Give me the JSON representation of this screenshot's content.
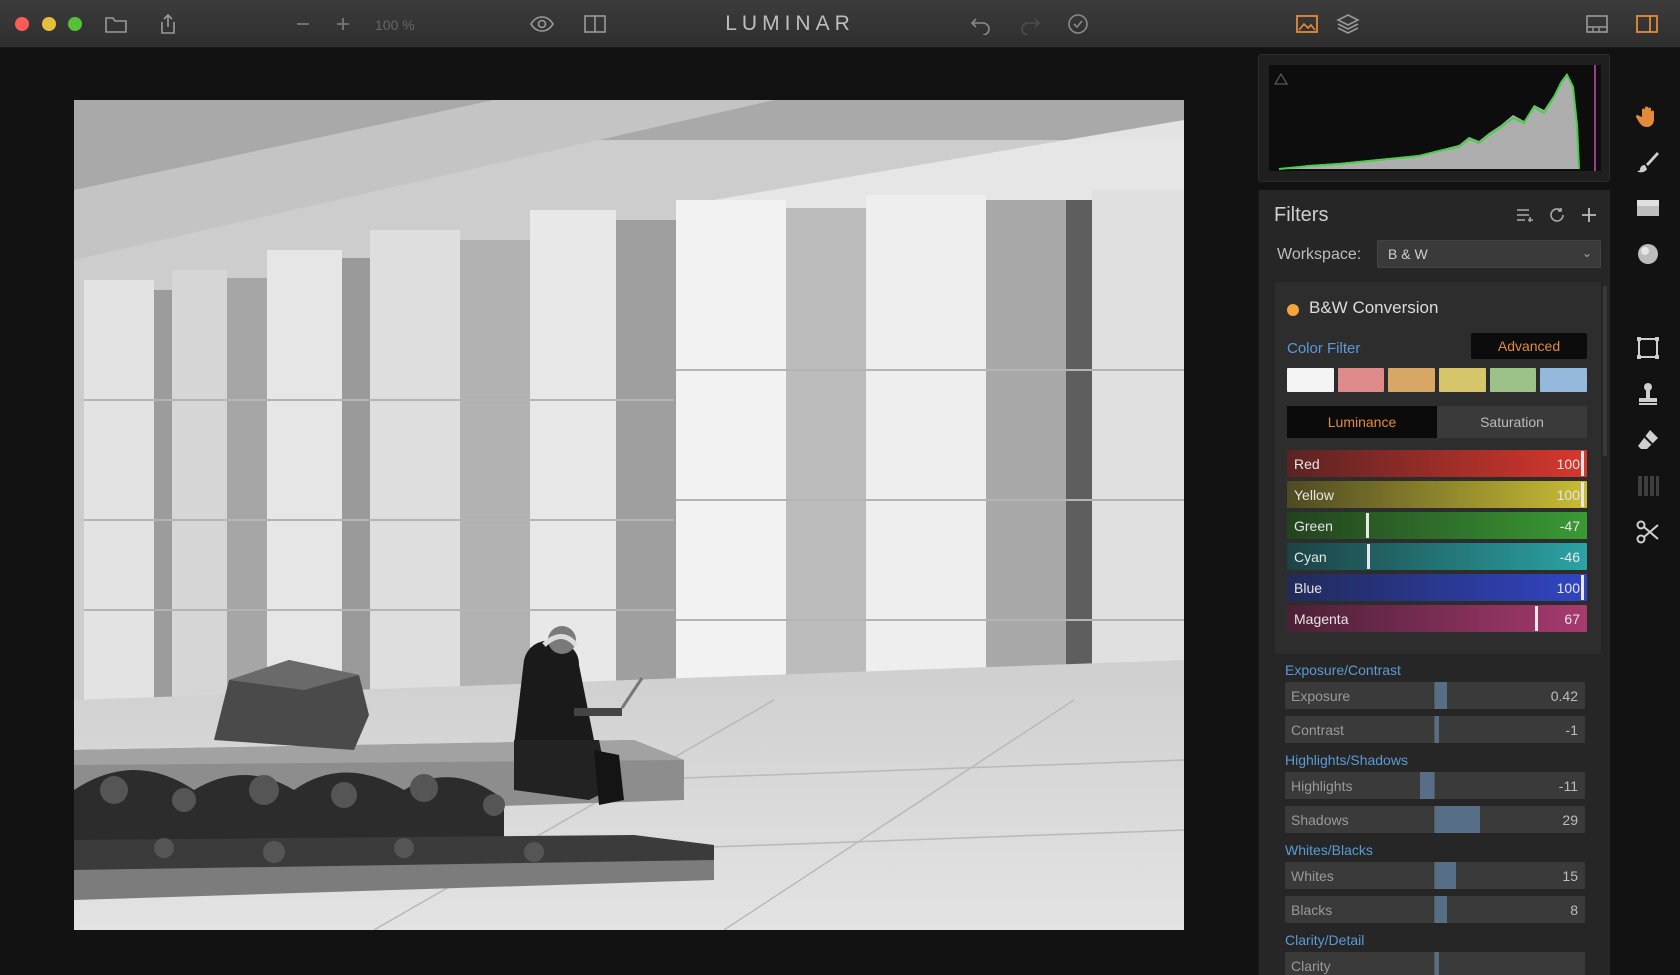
{
  "app": {
    "title": "LUMINAR",
    "zoom": "100 %"
  },
  "colors": {
    "accent": "#e38b3a",
    "section": "#5a9bd6",
    "panel": "#262626"
  },
  "toolbar": {
    "left_icons": [
      "folder-icon",
      "share-icon"
    ],
    "zoom_icons": [
      "zoom-out-icon",
      "zoom-in-icon"
    ],
    "view_icons": [
      "eye-icon",
      "compare-icon"
    ],
    "history_icons": [
      "undo-icon",
      "redo-icon",
      "history-icon"
    ],
    "panel_icons": [
      "image-icon",
      "layers-icon"
    ],
    "right_icons": [
      "filmstrip-icon",
      "sidebar-icon"
    ]
  },
  "filters": {
    "title": "Filters",
    "workspace_label": "Workspace:",
    "workspace_value": "B & W"
  },
  "bw": {
    "title": "B&W Conversion",
    "color_filter_label": "Color Filter",
    "advanced_label": "Advanced",
    "swatches": [
      "#f4f4f4",
      "#e08b8b",
      "#d8a765",
      "#d6c56b",
      "#9cc28a",
      "#94b9dc"
    ],
    "tabs": [
      "Luminance",
      "Saturation"
    ],
    "sliders": [
      {
        "label": "Red",
        "value": "100",
        "pos": 0.99,
        "c1": "#5a2323",
        "c2": "#d8372d"
      },
      {
        "label": "Yellow",
        "value": "100",
        "pos": 0.99,
        "c1": "#4e4a23",
        "c2": "#c9bd35"
      },
      {
        "label": "Green",
        "value": "-47",
        "pos": 0.265,
        "c1": "#23421f",
        "c2": "#3a9a34"
      },
      {
        "label": "Cyan",
        "value": "-46",
        "pos": 0.27,
        "c1": "#1d4244",
        "c2": "#2ba3a4"
      },
      {
        "label": "Blue",
        "value": "100",
        "pos": 0.99,
        "c1": "#222a58",
        "c2": "#3145c4"
      },
      {
        "label": "Magenta",
        "value": "67",
        "pos": 0.835,
        "c1": "#4b2036",
        "c2": "#a83a70"
      }
    ]
  },
  "sections": [
    {
      "title": "Exposure/Contrast",
      "sliders": [
        {
          "label": "Exposure",
          "value": "0.42",
          "fill": 0.04
        },
        {
          "label": "Contrast",
          "value": "-1",
          "fill": 0.0
        }
      ]
    },
    {
      "title": "Highlights/Shadows",
      "sliders": [
        {
          "label": "Highlights",
          "value": "-11",
          "fill": -0.05
        },
        {
          "label": "Shadows",
          "value": "29",
          "fill": 0.15
        }
      ]
    },
    {
      "title": "Whites/Blacks",
      "sliders": [
        {
          "label": "Whites",
          "value": "15",
          "fill": 0.07
        },
        {
          "label": "Blacks",
          "value": "8",
          "fill": 0.04
        }
      ]
    },
    {
      "title": "Clarity/Detail",
      "sliders": [
        {
          "label": "Clarity",
          "value": "",
          "fill": 0.0
        }
      ]
    }
  ],
  "tools": [
    "hand-icon",
    "brush-icon",
    "gradient-icon",
    "radial-mask-icon",
    "crop-icon",
    "clone-stamp-icon",
    "eraser-icon",
    "texture-icon",
    "transform-icon"
  ]
}
